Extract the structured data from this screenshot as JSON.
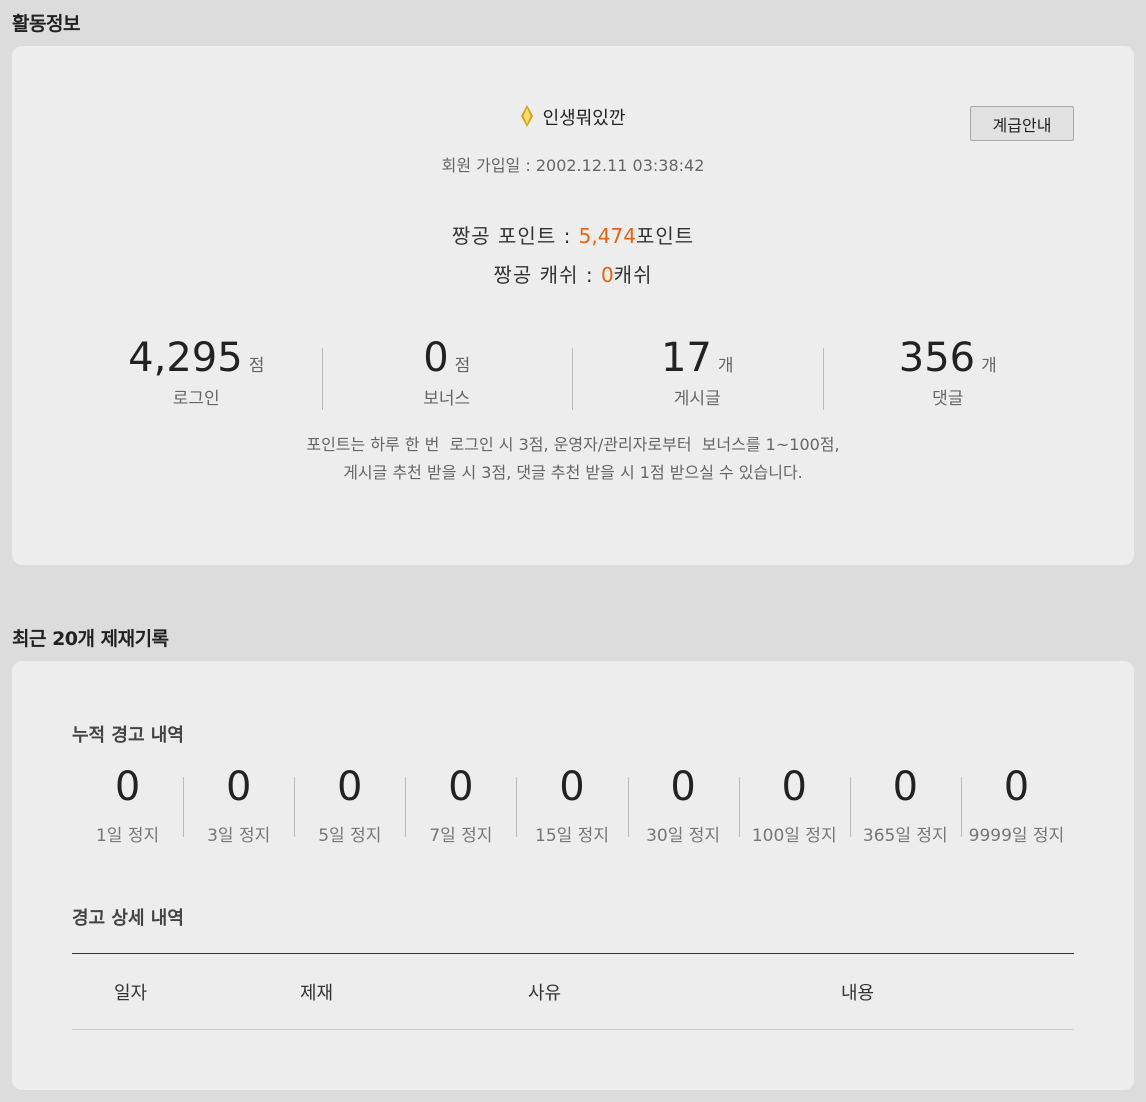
{
  "activity": {
    "section_title": "활동정보",
    "nickname": "인생뭐있깐",
    "join_label": "회원 가입일 : 2002.12.11 03:38:42",
    "grade_button": "계급안내",
    "point_label": "짱공 포인트 : ",
    "point_value": "5,474",
    "point_unit": "포인트",
    "cash_label": "짱공 캐쉬 : ",
    "cash_value": "0",
    "cash_unit": "캐쉬",
    "stats": [
      {
        "value": "4,295",
        "unit": "점",
        "label": "로그인"
      },
      {
        "value": "0",
        "unit": "점",
        "label": "보너스"
      },
      {
        "value": "17",
        "unit": "개",
        "label": "게시글"
      },
      {
        "value": "356",
        "unit": "개",
        "label": "댓글"
      }
    ],
    "note_line1": "포인트는 하루 한 번  로그인 시 3점, 운영자/관리자로부터  보너스를 1~100점,",
    "note_line2": "게시글 추천 받을 시 3점, 댓글 추천 받을 시 1점 받으실 수 있습니다.",
    "accent_color": "#e8650e"
  },
  "sanction": {
    "section_title": "최근 20개 제재기록",
    "cumulative_title": "누적 경고 내역",
    "warnings": [
      {
        "value": "0",
        "label": "1일 정지"
      },
      {
        "value": "0",
        "label": "3일 정지"
      },
      {
        "value": "0",
        "label": "5일 정지"
      },
      {
        "value": "0",
        "label": "7일 정지"
      },
      {
        "value": "0",
        "label": "15일 정지"
      },
      {
        "value": "0",
        "label": "30일 정지"
      },
      {
        "value": "0",
        "label": "100일 정지"
      },
      {
        "value": "0",
        "label": "365일 정지"
      },
      {
        "value": "0",
        "label": "9999일 정지"
      }
    ],
    "detail_title": "경고 상세 내역",
    "columns": [
      "일자",
      "제재",
      "사유",
      "내용"
    ]
  }
}
